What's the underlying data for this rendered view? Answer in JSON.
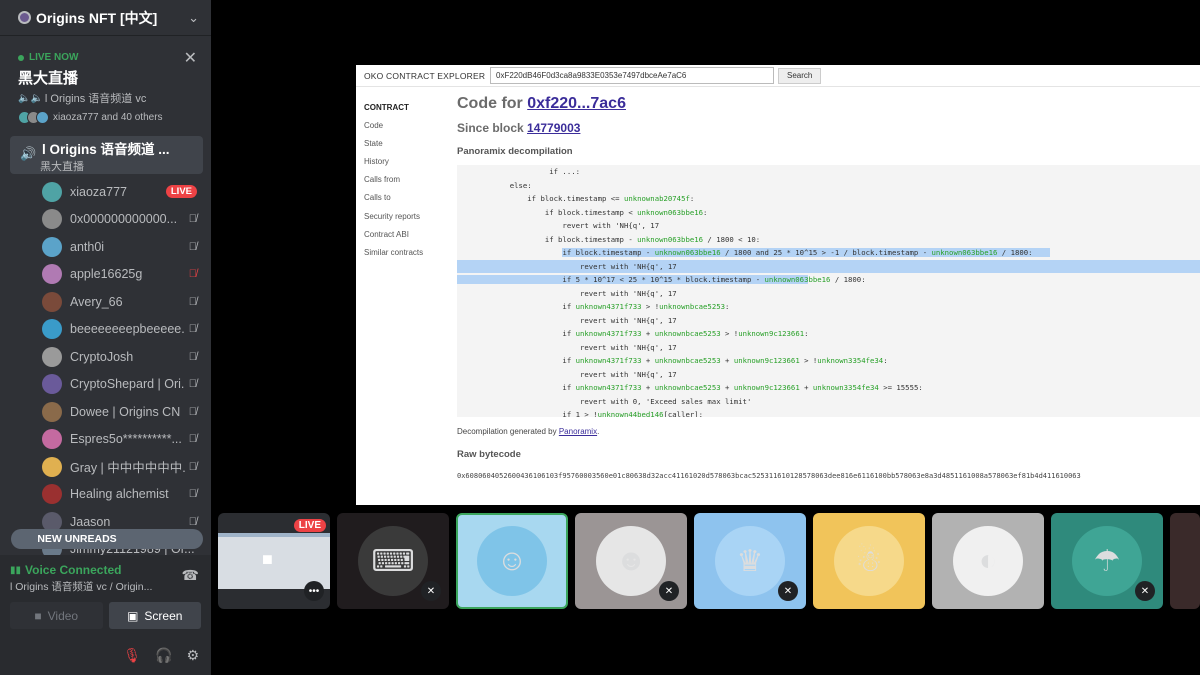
{
  "server": {
    "name": "Origins NFT [中文]"
  },
  "live_now": {
    "label": "LIVE NOW",
    "title": "黑大直播",
    "channel": "l Origins 语音频道 vc",
    "watchers": "xiaoza777 and 40 others"
  },
  "voice_channel": {
    "name": "l Origins 语音频道 ...",
    "subtitle": "黑大直播"
  },
  "members": [
    {
      "name": "xiaoza777",
      "badge": "LIVE",
      "color": "#4fa3a5"
    },
    {
      "name": "0x000000000000...",
      "color": "#8a8a8a"
    },
    {
      "name": "anth0i",
      "color": "#5ba3c9"
    },
    {
      "name": "apple16625g",
      "color": "#b07ab3",
      "mic_red": true
    },
    {
      "name": "Avery_66",
      "color": "#7a4a3a"
    },
    {
      "name": "beeeeeeeepbeeeee...",
      "color": "#3a9bc9"
    },
    {
      "name": "CryptoJosh",
      "color": "#9a9a9a"
    },
    {
      "name": "CryptoShepard | Ori...",
      "color": "#6a5a9a"
    },
    {
      "name": "Dowee | Origins CN",
      "color": "#8a6a4a"
    },
    {
      "name": "Espres5o**********...",
      "color": "#c46aa0"
    },
    {
      "name": "Gray | 中中中中中中...",
      "color": "#e0b050"
    },
    {
      "name": "Healing alchemist",
      "color": "#9a3030"
    },
    {
      "name": "Jaason",
      "color": "#5a5a6a"
    }
  ],
  "partial_member": "Jimmy21121989 | Or...",
  "new_unreads": "NEW UNREADS",
  "voice_connected": {
    "status": "Voice Connected",
    "channel": "l Origins 语音频道 vc / Origin...",
    "video_label": "Video",
    "screen_label": "Screen"
  },
  "browser": {
    "brand": "OKO CONTRACT EXPLORER",
    "search_value": "0xF220dB46F0d3ca8a9833E0353e7497dbceAe7aC6",
    "search_button": "Search",
    "nav": [
      "CONTRACT",
      "Code",
      "State",
      "History",
      "Calls from",
      "Calls to",
      "Security reports",
      "Contract ABI",
      "Similar contracts"
    ],
    "code_for": "Code for ",
    "address_short": "0xf220...7ac6",
    "since_block_label": "Since block ",
    "since_block": "14779003",
    "decomp_heading": "Panoramix decompilation",
    "decomp_note_prefix": "Decompilation generated by ",
    "decomp_note_link": "Panoramix",
    "decomp_note_suffix": ".",
    "raw_heading": "Raw bytecode",
    "raw_bytecode": "0x6080604052600436106103f95760003560e01c80638d32acc41161020d578063bcac525311610128578063dee816e6116100bb578063e8a3d4851161008a578063ef81b4d411610063"
  },
  "tiles": [
    {
      "kind": "stream",
      "live": "LIVE",
      "more": "•••"
    },
    {
      "kind": "avatar",
      "bg": "#201c1e",
      "face": "#3a3a3a",
      "glyph": "⌨",
      "muted": true
    },
    {
      "kind": "avatar",
      "bg": "#a8d8f0",
      "face": "#7fc4e8",
      "glyph": "☺",
      "speaking": true
    },
    {
      "kind": "avatar",
      "bg": "#9b9595",
      "face": "#e6e6e6",
      "glyph": "☻",
      "muted": true
    },
    {
      "kind": "avatar",
      "bg": "#8ec3ee",
      "face": "#a9d4f5",
      "glyph": "♛",
      "muted": true
    },
    {
      "kind": "avatar",
      "bg": "#f1c45a",
      "face": "#f6d98a",
      "glyph": "☃"
    },
    {
      "kind": "avatar",
      "bg": "#b2b2b2",
      "face": "#f0f0f0",
      "glyph": "◐"
    },
    {
      "kind": "avatar",
      "bg": "#2f8a7c",
      "face": "#3fa595",
      "glyph": "☂",
      "muted": true
    }
  ],
  "colors": {
    "green": "#3ba55c",
    "red": "#ed4245",
    "sidebar": "#2f3136"
  }
}
